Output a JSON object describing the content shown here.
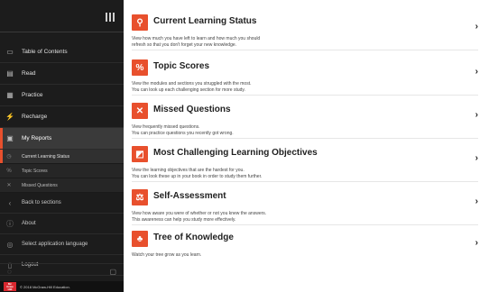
{
  "sidebar": {
    "nav": [
      {
        "label": "Table of Contents"
      },
      {
        "label": "Read"
      },
      {
        "label": "Practice"
      },
      {
        "label": "Recharge"
      },
      {
        "label": "My Reports"
      }
    ],
    "sub": [
      {
        "label": "Current Learning Status"
      },
      {
        "label": "Topic Scores"
      },
      {
        "label": "Missed Questions"
      }
    ],
    "lite": [
      {
        "label": "Back to sections"
      },
      {
        "label": "About"
      },
      {
        "label": "Select application language"
      },
      {
        "label": "Logout"
      }
    ],
    "footer": {
      "logo_line1": "Mc",
      "logo_line2": "Graw",
      "logo_line3": "Hill",
      "copyright": "© 2018 McGraw-Hill Education."
    }
  },
  "cards": [
    {
      "title": "Current Learning Status",
      "line1": "View how much you have left to learn and how much you should",
      "line2": "refresh so that you don't forget your new knowledge."
    },
    {
      "title": "Topic Scores",
      "line1": "View the modules and sections you struggled with the most.",
      "line2": "You can look up each challenging section for more study."
    },
    {
      "title": "Missed Questions",
      "line1": "View frequently missed questions.",
      "line2": "You can practice questions you recently got wrong."
    },
    {
      "title": "Most Challenging Learning Objectives",
      "line1": "View the learning objectives that are the hardest for you.",
      "line2": "You can look these up in your book in order to study them further."
    },
    {
      "title": "Self-Assessment",
      "line1": "View how aware you were of whether or not you knew the answers.",
      "line2": "This awareness can help you study more effectively."
    },
    {
      "title": "Tree of Knowledge",
      "line1": "Watch your tree grow as you learn.",
      "line2": ""
    }
  ],
  "colors": {
    "accent": "#e8502d",
    "sidebar_bg": "#1c1c1c",
    "active_bg": "#3a3a3a"
  }
}
